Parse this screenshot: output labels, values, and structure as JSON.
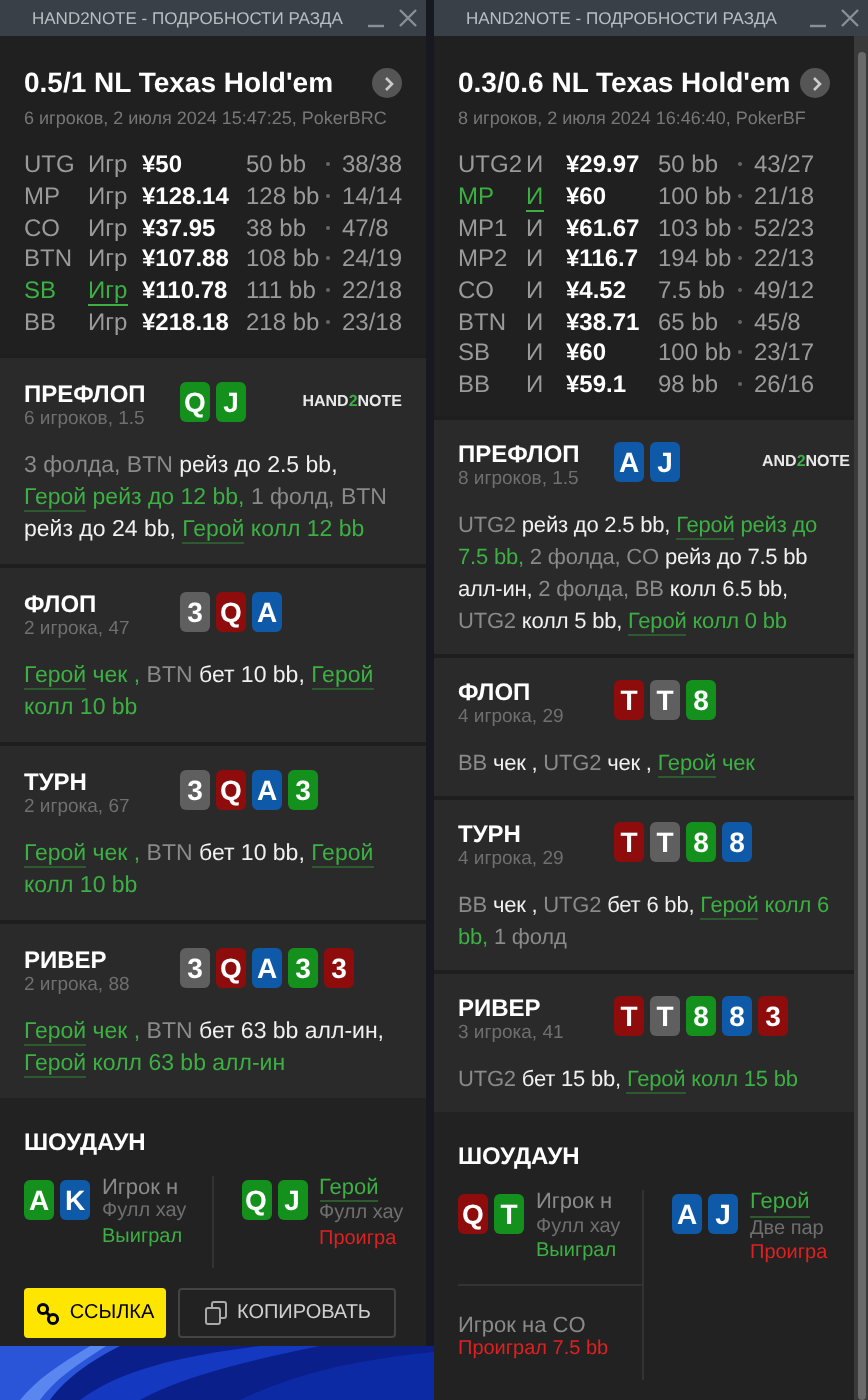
{
  "windows": [
    {
      "title": "HAND2NOTE - ПОДРОБНОСТИ РАЗДА",
      "game": "0.5/1 NL Texas Hold'em",
      "info": "6 игроков, 2 июля 2024 15:47:25, PokerBRC",
      "players": [
        {
          "pos": "UTG",
          "name": "Игр",
          "stack": "¥50",
          "bb": "50 bb",
          "stats": "38/38",
          "hero": false
        },
        {
          "pos": "MP",
          "name": "Игр",
          "stack": "¥128.14",
          "bb": "128 bb",
          "stats": "14/14",
          "hero": false
        },
        {
          "pos": "CO",
          "name": "Игр",
          "stack": "¥37.95",
          "bb": "38 bb",
          "stats": "47/8",
          "hero": false
        },
        {
          "pos": "BTN",
          "name": "Игр",
          "stack": "¥107.88",
          "bb": "108 bb",
          "stats": "24/19",
          "hero": false
        },
        {
          "pos": "SB",
          "name": "Игр",
          "stack": "¥110.78",
          "bb": "111 bb",
          "stats": "22/18",
          "hero": true
        },
        {
          "pos": "BB",
          "name": "Игр",
          "stack": "¥218.18",
          "bb": "218 bb",
          "stats": "23/18",
          "hero": false
        }
      ],
      "streets": [
        {
          "name": "ПРЕФЛОП",
          "info": "6 игроков, 1.5",
          "logo": [
            "HAND",
            "2",
            "NOTE"
          ],
          "cards": [
            {
              "rank": "Q",
              "color": "#14911c"
            },
            {
              "rank": "J",
              "color": "#14911c"
            }
          ],
          "actions": [
            {
              "text": "3 фолда, BTN ",
              "kind": "muted"
            },
            {
              "text": "рейз до 2.5 bb, ",
              "kind": "strong"
            },
            {
              "text": "Герой",
              "kind": "hero_name"
            },
            {
              "text": " рейз до 12 bb, ",
              "kind": "hero"
            },
            {
              "text": "1 фолд, BTN ",
              "kind": "muted"
            },
            {
              "text": "рейз до 24 bb, ",
              "kind": "strong"
            },
            {
              "text": "Герой",
              "kind": "hero_name"
            },
            {
              "text": " колл 12 bb",
              "kind": "hero"
            }
          ]
        },
        {
          "name": "ФЛОП",
          "info": "2 игрока, 47",
          "cards": [
            {
              "rank": "3",
              "color": "#5f5f5f"
            },
            {
              "rank": "Q",
              "color": "#8e0c0c"
            },
            {
              "rank": "A",
              "color": "#0f5aa8"
            }
          ],
          "actions": [
            {
              "text": "Герой",
              "kind": "hero_name"
            },
            {
              "text": " чек , ",
              "kind": "hero"
            },
            {
              "text": "BTN ",
              "kind": "muted"
            },
            {
              "text": "бет 10 bb, ",
              "kind": "strong"
            },
            {
              "text": "Герой",
              "kind": "hero_name"
            },
            {
              "text": " колл 10 bb",
              "kind": "hero"
            }
          ]
        },
        {
          "name": "ТУРН",
          "info": "2 игрока, 67",
          "cards": [
            {
              "rank": "3",
              "color": "#5f5f5f"
            },
            {
              "rank": "Q",
              "color": "#8e0c0c"
            },
            {
              "rank": "A",
              "color": "#0f5aa8"
            },
            {
              "rank": "3",
              "color": "#14911c"
            }
          ],
          "actions": [
            {
              "text": "Герой",
              "kind": "hero_name"
            },
            {
              "text": " чек , ",
              "kind": "hero"
            },
            {
              "text": "BTN ",
              "kind": "muted"
            },
            {
              "text": "бет 10 bb, ",
              "kind": "strong"
            },
            {
              "text": "Герой",
              "kind": "hero_name"
            },
            {
              "text": " колл 10 bb",
              "kind": "hero"
            }
          ]
        },
        {
          "name": "РИВЕР",
          "info": "2 игрока, 88",
          "cards": [
            {
              "rank": "3",
              "color": "#5f5f5f"
            },
            {
              "rank": "Q",
              "color": "#8e0c0c"
            },
            {
              "rank": "A",
              "color": "#0f5aa8"
            },
            {
              "rank": "3",
              "color": "#14911c"
            },
            {
              "rank": "3",
              "color": "#8e0c0c"
            }
          ],
          "actions": [
            {
              "text": "Герой",
              "kind": "hero_name"
            },
            {
              "text": " чек , ",
              "kind": "hero"
            },
            {
              "text": "BTN ",
              "kind": "muted"
            },
            {
              "text": "бет 63 bb алл-ин, ",
              "kind": "strong"
            },
            {
              "text": "Герой",
              "kind": "hero_name"
            },
            {
              "text": " колл 63 bb алл-ин",
              "kind": "hero"
            }
          ]
        }
      ],
      "showdown": {
        "title": "ШОУДАУН",
        "hands": [
          {
            "cards": [
              {
                "rank": "A",
                "color": "#14911c"
              },
              {
                "rank": "K",
                "color": "#0f5aa8"
              }
            ],
            "name": "Игрок н",
            "hero": false,
            "hand": "Фулл хау",
            "result": "Выиграл",
            "won": true
          },
          {
            "cards": [
              {
                "rank": "Q",
                "color": "#14911c"
              },
              {
                "rank": "J",
                "color": "#14911c"
              }
            ],
            "name": "Герой",
            "hero": true,
            "hand": "Фулл хау",
            "result": "Проигра",
            "won": false
          }
        ]
      },
      "buttons": [
        {
          "label": "ССЫЛКА",
          "kind": "link"
        },
        {
          "label": "КОПИРОВАТЬ",
          "kind": "copy"
        }
      ]
    },
    {
      "title": "HAND2NOTE - ПОДРОБНОСТИ РАЗДА",
      "game": "0.3/0.6 NL Texas Hold'em",
      "info": "8 игроков, 2 июля 2024 16:46:40, PokerBF",
      "players": [
        {
          "pos": "UTG2",
          "name": "И",
          "stack": "¥29.97",
          "bb": "50 bb",
          "stats": "43/27",
          "hero": false
        },
        {
          "pos": "MP",
          "name": "И",
          "stack": "¥60",
          "bb": "100 bb",
          "stats": "21/18",
          "hero": true
        },
        {
          "pos": "MP1",
          "name": "И",
          "stack": "¥61.67",
          "bb": "103 bb",
          "stats": "52/23",
          "hero": false
        },
        {
          "pos": "MP2",
          "name": "И",
          "stack": "¥116.7",
          "bb": "194 bb",
          "stats": "22/13",
          "hero": false
        },
        {
          "pos": "CO",
          "name": "И",
          "stack": "¥4.52",
          "bb": "7.5 bb",
          "stats": "49/12",
          "hero": false
        },
        {
          "pos": "BTN",
          "name": "И",
          "stack": "¥38.71",
          "bb": "65 bb",
          "stats": "45/8",
          "hero": false
        },
        {
          "pos": "SB",
          "name": "И",
          "stack": "¥60",
          "bb": "100 bb",
          "stats": "23/17",
          "hero": false
        },
        {
          "pos": "BB",
          "name": "И",
          "stack": "¥59.1",
          "bb": "98 bb",
          "stats": "26/16",
          "hero": false
        }
      ],
      "streets": [
        {
          "name": "ПРЕФЛОП",
          "info": "8 игроков, 1.5",
          "logo": [
            "AND",
            "2",
            "NOTE"
          ],
          "cards": [
            {
              "rank": "A",
              "color": "#0f5aa8"
            },
            {
              "rank": "J",
              "color": "#0f5aa8"
            }
          ],
          "actions": [
            {
              "text": "UTG2 ",
              "kind": "muted"
            },
            {
              "text": "рейз до 2.5 bb, ",
              "kind": "strong"
            },
            {
              "text": "Герой",
              "kind": "hero_name"
            },
            {
              "text": " рейз до 7.5 bb, ",
              "kind": "hero"
            },
            {
              "text": "2 фолда, CO ",
              "kind": "muted"
            },
            {
              "text": "рейз до 7.5 bb алл-ин, ",
              "kind": "strong"
            },
            {
              "text": "2 фолда, BB ",
              "kind": "muted"
            },
            {
              "text": "колл 6.5 bb, ",
              "kind": "strong"
            },
            {
              "text": "UTG2 ",
              "kind": "muted"
            },
            {
              "text": "колл 5 bb, ",
              "kind": "strong"
            },
            {
              "text": "Герой",
              "kind": "hero_name"
            },
            {
              "text": " колл 0 bb",
              "kind": "hero"
            }
          ]
        },
        {
          "name": "ФЛОП",
          "info": "4 игрока, 29",
          "cards": [
            {
              "rank": "T",
              "color": "#8e0c0c"
            },
            {
              "rank": "T",
              "color": "#5f5f5f"
            },
            {
              "rank": "8",
              "color": "#14911c"
            }
          ],
          "actions": [
            {
              "text": "BB ",
              "kind": "muted"
            },
            {
              "text": "чек , ",
              "kind": "strong"
            },
            {
              "text": "UTG2 ",
              "kind": "muted"
            },
            {
              "text": "чек , ",
              "kind": "strong"
            },
            {
              "text": "Герой",
              "kind": "hero_name"
            },
            {
              "text": " чек",
              "kind": "hero"
            }
          ]
        },
        {
          "name": "ТУРН",
          "info": "4 игрока, 29",
          "cards": [
            {
              "rank": "T",
              "color": "#8e0c0c"
            },
            {
              "rank": "T",
              "color": "#5f5f5f"
            },
            {
              "rank": "8",
              "color": "#14911c"
            },
            {
              "rank": "8",
              "color": "#0f5aa8"
            }
          ],
          "actions": [
            {
              "text": "BB ",
              "kind": "muted"
            },
            {
              "text": "чек , ",
              "kind": "strong"
            },
            {
              "text": "UTG2 ",
              "kind": "muted"
            },
            {
              "text": "бет 6 bb, ",
              "kind": "strong"
            },
            {
              "text": "Герой",
              "kind": "hero_name"
            },
            {
              "text": " колл 6 bb, ",
              "kind": "hero"
            },
            {
              "text": "1 фолд",
              "kind": "muted"
            }
          ]
        },
        {
          "name": "РИВЕР",
          "info": "3 игрока, 41",
          "cards": [
            {
              "rank": "T",
              "color": "#8e0c0c"
            },
            {
              "rank": "T",
              "color": "#5f5f5f"
            },
            {
              "rank": "8",
              "color": "#14911c"
            },
            {
              "rank": "8",
              "color": "#0f5aa8"
            },
            {
              "rank": "3",
              "color": "#8e0c0c"
            }
          ],
          "actions": [
            {
              "text": "UTG2 ",
              "kind": "muted"
            },
            {
              "text": "бет 15 bb, ",
              "kind": "strong"
            },
            {
              "text": "Герой",
              "kind": "hero_name"
            },
            {
              "text": " колл 15 bb",
              "kind": "hero"
            }
          ]
        }
      ],
      "showdown": {
        "title": "ШОУДАУН",
        "hands": [
          {
            "cards": [
              {
                "rank": "Q",
                "color": "#8e0c0c"
              },
              {
                "rank": "T",
                "color": "#14911c"
              }
            ],
            "name": "Игрок н",
            "hero": false,
            "hand": "Фулл хау",
            "result": "Выиграл",
            "won": true
          },
          {
            "cards": [
              {
                "rank": "A",
                "color": "#0f5aa8"
              },
              {
                "rank": "J",
                "color": "#0f5aa8"
              }
            ],
            "name": "Герой",
            "hero": true,
            "hand": "Две пар",
            "result": "Проигра",
            "won": false
          },
          {
            "name": "Игрок на CO",
            "hero": false,
            "result": "Проиграл 7.5 bb",
            "won": false
          }
        ]
      }
    }
  ]
}
